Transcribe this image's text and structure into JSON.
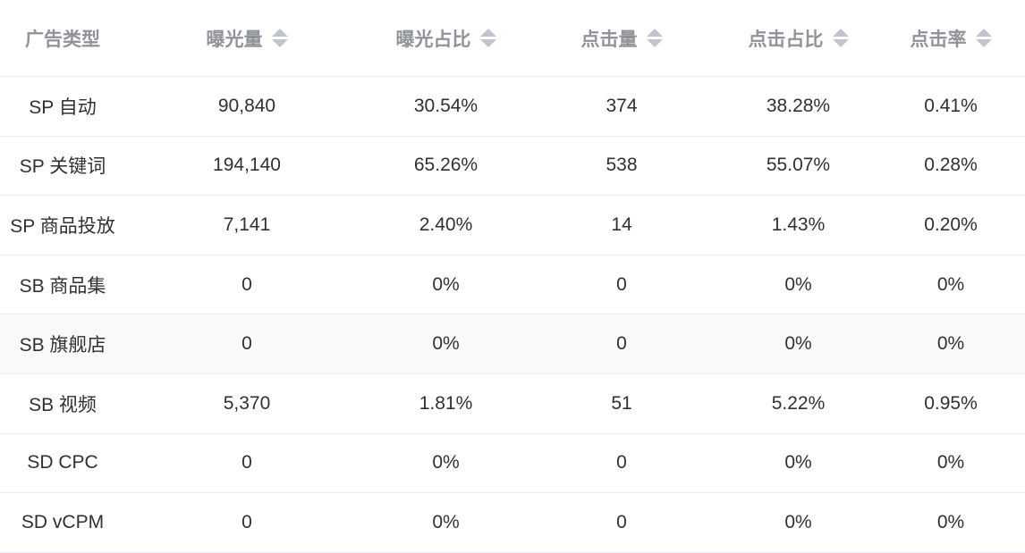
{
  "columns": [
    {
      "label": "广告类型",
      "sortable": false
    },
    {
      "label": "曝光量",
      "sortable": true
    },
    {
      "label": "曝光占比",
      "sortable": true
    },
    {
      "label": "点击量",
      "sortable": true
    },
    {
      "label": "点击占比",
      "sortable": true
    },
    {
      "label": "点击率",
      "sortable": true
    }
  ],
  "rows": [
    [
      "SP 自动",
      "90,840",
      "30.54%",
      "374",
      "38.28%",
      "0.41%"
    ],
    [
      "SP 关键词",
      "194,140",
      "65.26%",
      "538",
      "55.07%",
      "0.28%"
    ],
    [
      "SP 商品投放",
      "7,141",
      "2.40%",
      "14",
      "1.43%",
      "0.20%"
    ],
    [
      "SB 商品集",
      "0",
      "0%",
      "0",
      "0%",
      "0%"
    ],
    [
      "SB 旗舰店",
      "0",
      "0%",
      "0",
      "0%",
      "0%"
    ],
    [
      "SB 视频",
      "5,370",
      "1.81%",
      "51",
      "5.22%",
      "0.95%"
    ],
    [
      "SD CPC",
      "0",
      "0%",
      "0",
      "0%",
      "0%"
    ],
    [
      "SD vCPM",
      "0",
      "0%",
      "0",
      "0%",
      "0%"
    ]
  ],
  "colors": {
    "header_text": "#909399",
    "body_text": "#303133",
    "border": "#ebeef5",
    "hover_row_bg": "#f8f9fb",
    "sort_icon": "#c0c4cc"
  },
  "highlighted_row_index": 4
}
